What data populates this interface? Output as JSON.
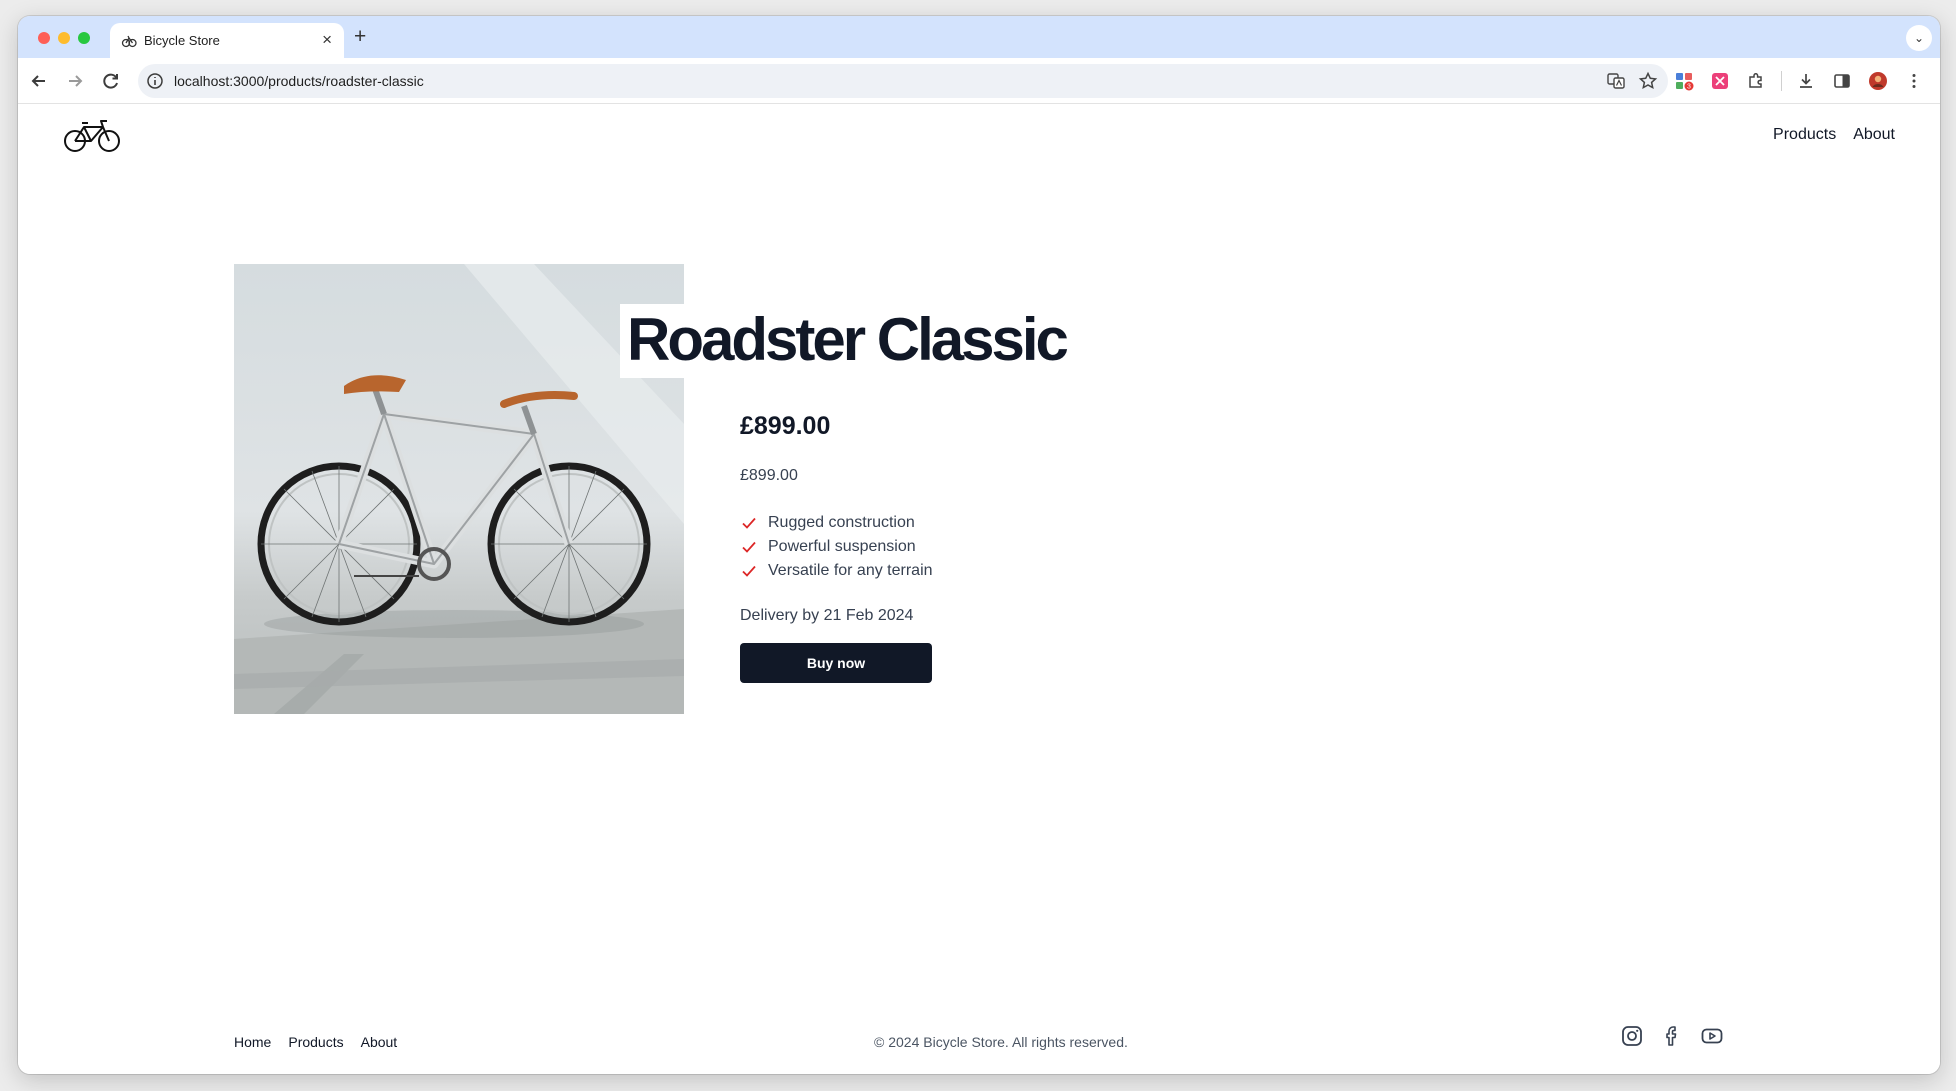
{
  "browser": {
    "tab_title": "Bicycle Store",
    "tab_close": "×",
    "new_tab": "+",
    "tab_search": "⌄",
    "url": "localhost:3000/products/roadster-classic",
    "extension_badge": "3"
  },
  "site": {
    "nav": [
      "Products",
      "About"
    ]
  },
  "product": {
    "name": "Roadster Classic",
    "price": "£899.00",
    "price_secondary": "£899.00",
    "features": [
      "Rugged construction",
      "Powerful suspension",
      "Versatile for any terrain"
    ],
    "delivery": "Delivery by 21 Feb 2024",
    "buy_label": "Buy now"
  },
  "footer": {
    "nav": [
      "Home",
      "Products",
      "About"
    ],
    "copyright": "© 2024 Bicycle Store. All rights reserved.",
    "social": [
      "instagram-icon",
      "facebook-icon",
      "youtube-icon"
    ]
  },
  "colors": {
    "primary": "#111827",
    "check": "#dc2626",
    "tabstrip": "#d3e3fd"
  }
}
